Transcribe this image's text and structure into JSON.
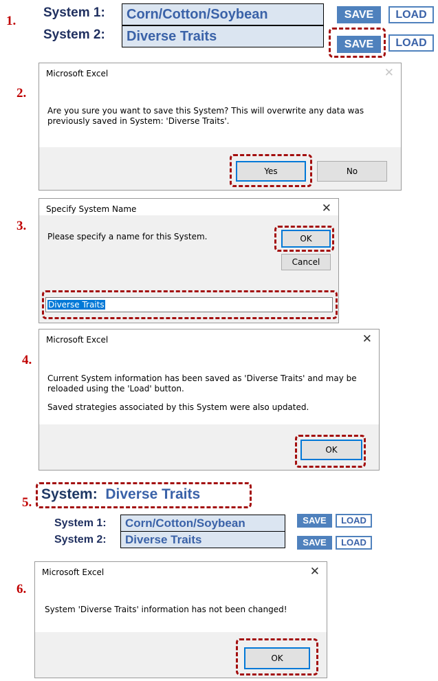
{
  "steps": [
    "1.",
    "2.",
    "3.",
    "4.",
    "5.",
    "6."
  ],
  "systems_panel": {
    "system1_label": "System 1:",
    "system1_value": "Corn/Cotton/Soybean",
    "system2_label": "System 2:",
    "system2_value": "Diverse Traits",
    "save_label": "SAVE",
    "load_label": "LOAD"
  },
  "dialog_confirm": {
    "title": "Microsoft Excel",
    "close": "✕",
    "message_line1": "Are you sure you want to save this System? This will overwrite any data was",
    "message_line2": "previously saved in System: 'Diverse Traits'.",
    "yes_label": "Yes",
    "no_label": "No"
  },
  "dialog_name": {
    "title": "Specify System Name",
    "close": "✕",
    "prompt": "Please specify a name for this System.",
    "ok_label": "OK",
    "cancel_label": "Cancel",
    "input_value": "Diverse Traits"
  },
  "dialog_saved": {
    "title": "Microsoft Excel",
    "close": "✕",
    "message_line1": "Current System information has been saved as 'Diverse Traits' and may be",
    "message_line2": "reloaded using the 'Load' button.",
    "message_line3": "Saved strategies associated by this System were also updated.",
    "ok_label": "OK"
  },
  "current_system": {
    "label": "System:",
    "value": "Diverse Traits"
  },
  "dialog_unchanged": {
    "title": "Microsoft Excel",
    "close": "✕",
    "message": "System 'Diverse Traits' information has not been changed!",
    "ok_label": "OK"
  },
  "colors": {
    "highlight": "#a30e0e",
    "step_number": "#c00000",
    "save_button": "#4f81bd",
    "system_field_bg": "#dbe5f1"
  }
}
